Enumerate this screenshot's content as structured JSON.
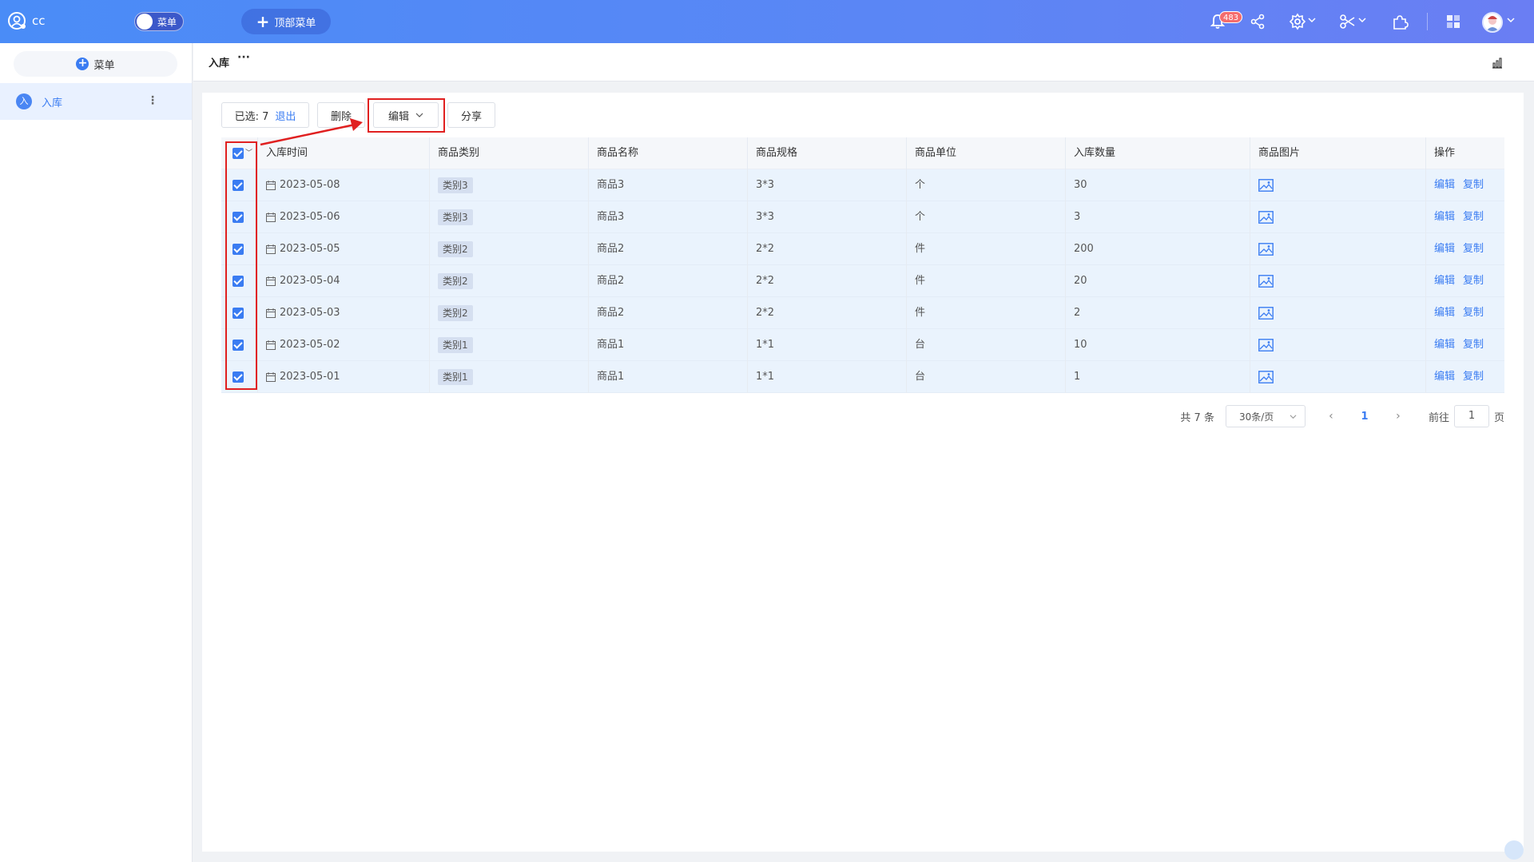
{
  "topbar": {
    "logo_text": "cc",
    "switch_label": "菜单",
    "top_menu_label": "顶部菜单",
    "notification_count": "483",
    "accent": "#4a8cf7"
  },
  "sidebar": {
    "add_menu_label": "菜单",
    "items": [
      {
        "icon_letter": "入",
        "label": "入库"
      }
    ]
  },
  "page": {
    "title": "入库",
    "more": "···"
  },
  "toolbar": {
    "selected_label": "已选: 7",
    "exit_label": "退出",
    "delete_label": "删除",
    "edit_label": "编辑",
    "share_label": "分享"
  },
  "table": {
    "columns": [
      "入库时间",
      "商品类别",
      "商品名称",
      "商品规格",
      "商品单位",
      "入库数量",
      "商品图片",
      "操作"
    ],
    "rows": [
      {
        "date": "2023-05-08",
        "category": "类别3",
        "name": "商品3",
        "spec": "3*3",
        "unit": "个",
        "qty": "30"
      },
      {
        "date": "2023-05-06",
        "category": "类别3",
        "name": "商品3",
        "spec": "3*3",
        "unit": "个",
        "qty": "3"
      },
      {
        "date": "2023-05-05",
        "category": "类别2",
        "name": "商品2",
        "spec": "2*2",
        "unit": "件",
        "qty": "200"
      },
      {
        "date": "2023-05-04",
        "category": "类别2",
        "name": "商品2",
        "spec": "2*2",
        "unit": "件",
        "qty": "20"
      },
      {
        "date": "2023-05-03",
        "category": "类别2",
        "name": "商品2",
        "spec": "2*2",
        "unit": "件",
        "qty": "2"
      },
      {
        "date": "2023-05-02",
        "category": "类别1",
        "name": "商品1",
        "spec": "1*1",
        "unit": "台",
        "qty": "10"
      },
      {
        "date": "2023-05-01",
        "category": "类别1",
        "name": "商品1",
        "spec": "1*1",
        "unit": "台",
        "qty": "1"
      }
    ],
    "action_edit": "编辑",
    "action_copy": "复制"
  },
  "pagination": {
    "total_label": "共 7 条",
    "page_size": "30条/页",
    "current_page": "1",
    "goto_label": "前往",
    "goto_value": "1",
    "page_suffix": "页"
  }
}
